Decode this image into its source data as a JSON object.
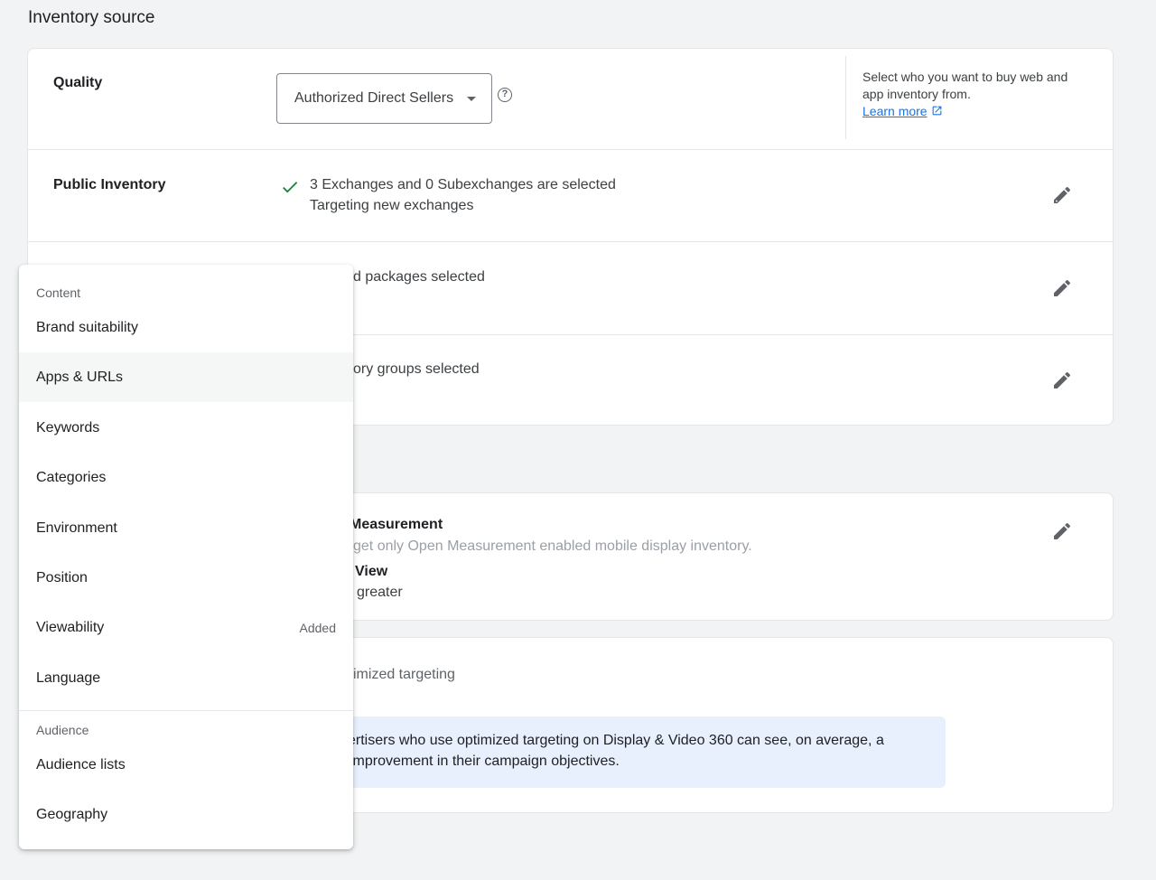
{
  "section_title": "Inventory source",
  "quality": {
    "label": "Quality",
    "dropdown_value": "Authorized Direct Sellers",
    "description": "Select who you want to buy web and app inventory from.",
    "learn_more": "Learn more"
  },
  "public_inventory": {
    "label": "Public Inventory",
    "line1": "3 Exchanges and 0 Subexchanges are selected",
    "line2": "Targeting new exchanges"
  },
  "deals_row": {
    "line1": "d packages selected"
  },
  "groups_row": {
    "line1": "ory groups selected"
  },
  "card_b": {
    "title1": "Measurement",
    "desc1": "get only Open Measurement enabled mobile display inventory.",
    "title2": "View",
    "desc2": "greater"
  },
  "card_c": {
    "line1": "imized targeting",
    "banner_line1": "ertisers who use optimized targeting on Display & Video 360 can see, on average, a",
    "banner_line2": "improvement in their campaign objectives."
  },
  "menu": {
    "content_header": "Content",
    "audience_header": "Audience",
    "items": [
      {
        "label": "Brand suitability",
        "badge": ""
      },
      {
        "label": "Apps & URLs",
        "badge": ""
      },
      {
        "label": "Keywords",
        "badge": ""
      },
      {
        "label": "Categories",
        "badge": ""
      },
      {
        "label": "Environment",
        "badge": ""
      },
      {
        "label": "Position",
        "badge": ""
      },
      {
        "label": "Viewability",
        "badge": "Added"
      },
      {
        "label": "Language",
        "badge": ""
      }
    ],
    "audience_items": [
      {
        "label": "Audience lists"
      },
      {
        "label": "Geography"
      }
    ]
  },
  "colors": {
    "accent": "#1a73e8",
    "check": "#188038",
    "banner": "#e8f0fe"
  }
}
